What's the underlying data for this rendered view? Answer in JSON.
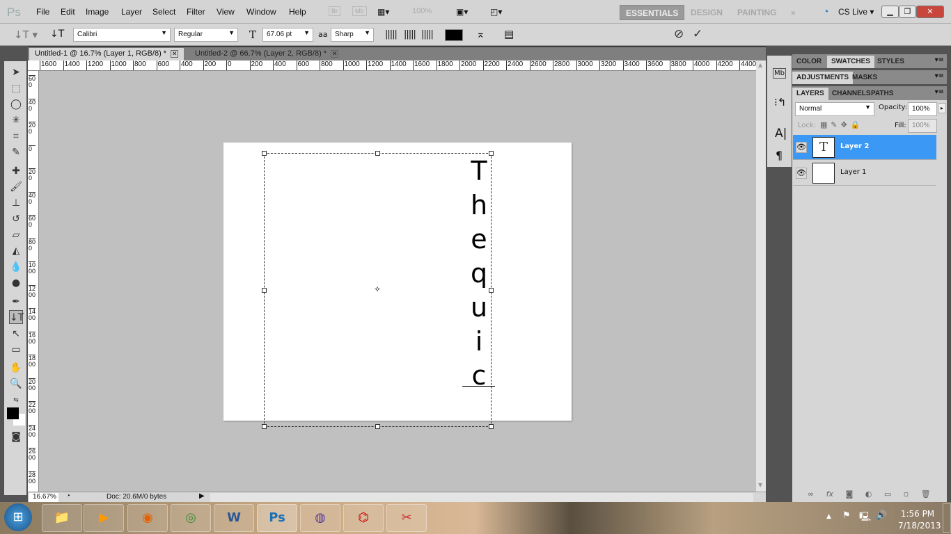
{
  "app": {
    "logo": "Ps",
    "menu": [
      "File",
      "Edit",
      "Image",
      "Layer",
      "Select",
      "Filter",
      "View",
      "Window",
      "Help"
    ],
    "bridge": "Br",
    "minibridge": "Mb",
    "zoom_display": "100%",
    "workspaces": [
      "ESSENTIALS",
      "DESIGN",
      "PAINTING"
    ],
    "active_workspace": "ESSENTIALS",
    "more": "»",
    "cslive": "CS Live"
  },
  "options": {
    "font_family": "Calibri",
    "font_style": "Regular",
    "font_size": "67.06 pt",
    "antialias_icon": "aa",
    "antialias": "Sharp",
    "text_color": "#000000",
    "cancel": "⊘",
    "commit": "✓"
  },
  "tabs": [
    {
      "label": "Untitled-1 @ 16.7% (Layer 1, RGB/8) *",
      "active": true
    },
    {
      "label": "Untitled-2 @ 66.7% (Layer 2, RGB/8) *",
      "active": false
    }
  ],
  "ruler": {
    "h": [
      "1600",
      "1400",
      "1200",
      "1000",
      "800",
      "600",
      "400",
      "200",
      "0",
      "200",
      "400",
      "600",
      "800",
      "1000",
      "1200",
      "1400",
      "1600",
      "1800",
      "2000",
      "2200",
      "2400",
      "2600",
      "2800",
      "3000",
      "3200",
      "3400",
      "3600",
      "3800",
      "4000",
      "4200",
      "4400"
    ],
    "v": [
      "600",
      "400",
      "200",
      "0",
      "200",
      "400",
      "600",
      "800",
      "1000",
      "1200",
      "1400",
      "1600",
      "1800",
      "2000",
      "2200",
      "2400",
      "2600",
      "2800"
    ]
  },
  "canvas": {
    "text_chars": [
      "T",
      "h",
      "e",
      "q",
      "u",
      "i",
      "c"
    ]
  },
  "status": {
    "zoom": "16.67%",
    "doc": "Doc: 20.6M/0 bytes"
  },
  "panels": {
    "group1": [
      "COLOR",
      "SWATCHES",
      "STYLES"
    ],
    "group2": [
      "ADJUSTMENTS",
      "MASKS"
    ],
    "group3": [
      "LAYERS",
      "CHANNELS",
      "PATHS"
    ],
    "blend_mode": "Normal",
    "opacity_label": "Opacity:",
    "opacity": "100%",
    "lock_label": "Lock:",
    "fill_label": "Fill:",
    "fill": "100%",
    "layers": [
      {
        "name": "Layer 2",
        "type": "text",
        "thumb": "T",
        "selected": true
      },
      {
        "name": "Layer 1",
        "type": "pixel",
        "thumb": "",
        "selected": false
      }
    ],
    "footer_icons": [
      "link",
      "fx",
      "mask",
      "adjustment",
      "group",
      "new-layer",
      "trash"
    ]
  },
  "taskbar": {
    "apps": [
      "explorer",
      "media-player",
      "firefox",
      "chrome",
      "word",
      "photoshop",
      "torrent",
      "acrobat",
      "snipping-tool"
    ],
    "time": "1:56 PM",
    "date": "7/18/2013"
  }
}
